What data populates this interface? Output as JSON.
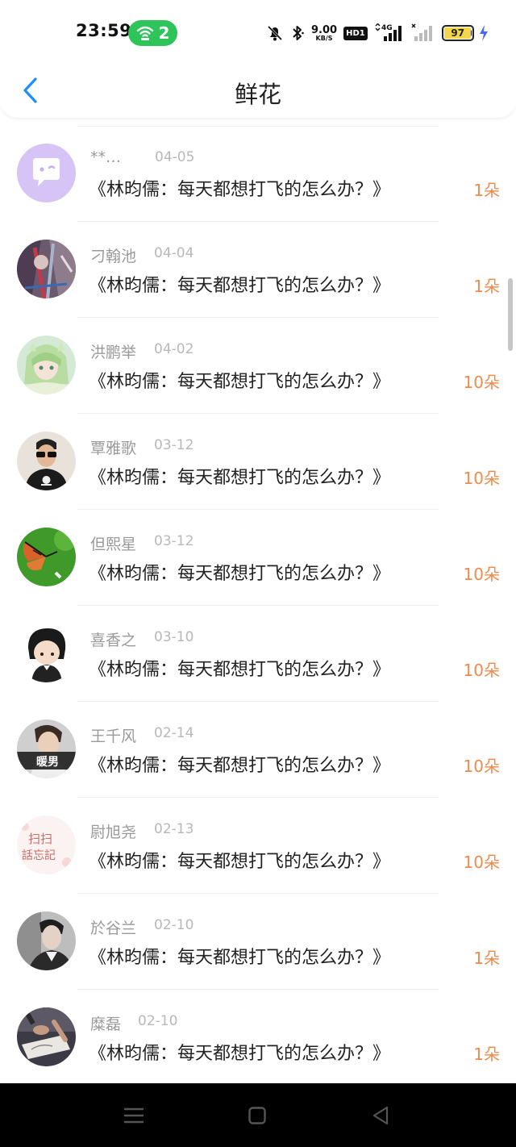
{
  "status_bar": {
    "time": "23:59",
    "hotspot_count": "2",
    "net_speed_value": "9.00",
    "net_speed_unit": "KB/S",
    "hd_label": "HD1",
    "network_type": "4G",
    "battery_level": "97",
    "battery_fraction": 0.97,
    "hotspot_color": "#2dc459",
    "battery_color": "#f5d64a"
  },
  "header": {
    "title": "鲜花",
    "back_icon": "chevron-left-icon",
    "accent_color": "#1e8fff"
  },
  "items": [
    {
      "name": "**…",
      "date": "04-05",
      "title": "《林昀儒：每天都想打飞的怎么办？》",
      "qty": "1朵",
      "avatar": "default-chat-avatar"
    },
    {
      "name": "刁翰池",
      "date": "04-04",
      "title": "《林昀儒：每天都想打飞的怎么办？》",
      "qty": "1朵",
      "avatar": "anime-art-avatar"
    },
    {
      "name": "洪鹏举",
      "date": "04-02",
      "title": "《林昀儒：每天都想打飞的怎么办？》",
      "qty": "10朵",
      "avatar": "anime-girl-avatar"
    },
    {
      "name": "覃雅歌",
      "date": "03-12",
      "title": "《林昀儒：每天都想打飞的怎么办？》",
      "qty": "10朵",
      "avatar": "man-sunglasses-avatar"
    },
    {
      "name": "但熙星",
      "date": "03-12",
      "title": "《林昀儒：每天都想打飞的怎么办？》",
      "qty": "10朵",
      "avatar": "butterfly-avatar"
    },
    {
      "name": "喜香之",
      "date": "03-10",
      "title": "《林昀儒：每天都想打飞的怎么办？》",
      "qty": "10朵",
      "avatar": "cartoon-boy-avatar"
    },
    {
      "name": "王千风",
      "date": "02-14",
      "title": "《林昀儒：每天都想打飞的怎么办？》",
      "qty": "10朵",
      "avatar": "boy-photo-avatar"
    },
    {
      "name": "尉旭尧",
      "date": "02-13",
      "title": "《林昀儒：每天都想打飞的怎么办？》",
      "qty": "10朵",
      "avatar": "calligraphy-avatar"
    },
    {
      "name": "於谷兰",
      "date": "02-10",
      "title": "《林昀儒：每天都想打飞的怎么办？》",
      "qty": "1朵",
      "avatar": "man-portrait-avatar"
    },
    {
      "name": "糜磊",
      "date": "02-10",
      "title": "《林昀儒：每天都想打飞的怎么办？》",
      "qty": "1朵",
      "avatar": "hands-photo-avatar"
    }
  ],
  "avatar_text": {
    "boy_photo": "暖男",
    "calligraphy_line1": "扫扫",
    "calligraphy_line2": "話忘記"
  },
  "colors": {
    "quantity": "#f08a4b",
    "name": "#9a9a9a",
    "date": "#b8b8b8",
    "default_avatar": "#d7c4f7"
  },
  "nav_bar": {
    "menu_icon": "menu-icon",
    "home_icon": "home-square-icon",
    "back_icon": "back-triangle-icon"
  }
}
